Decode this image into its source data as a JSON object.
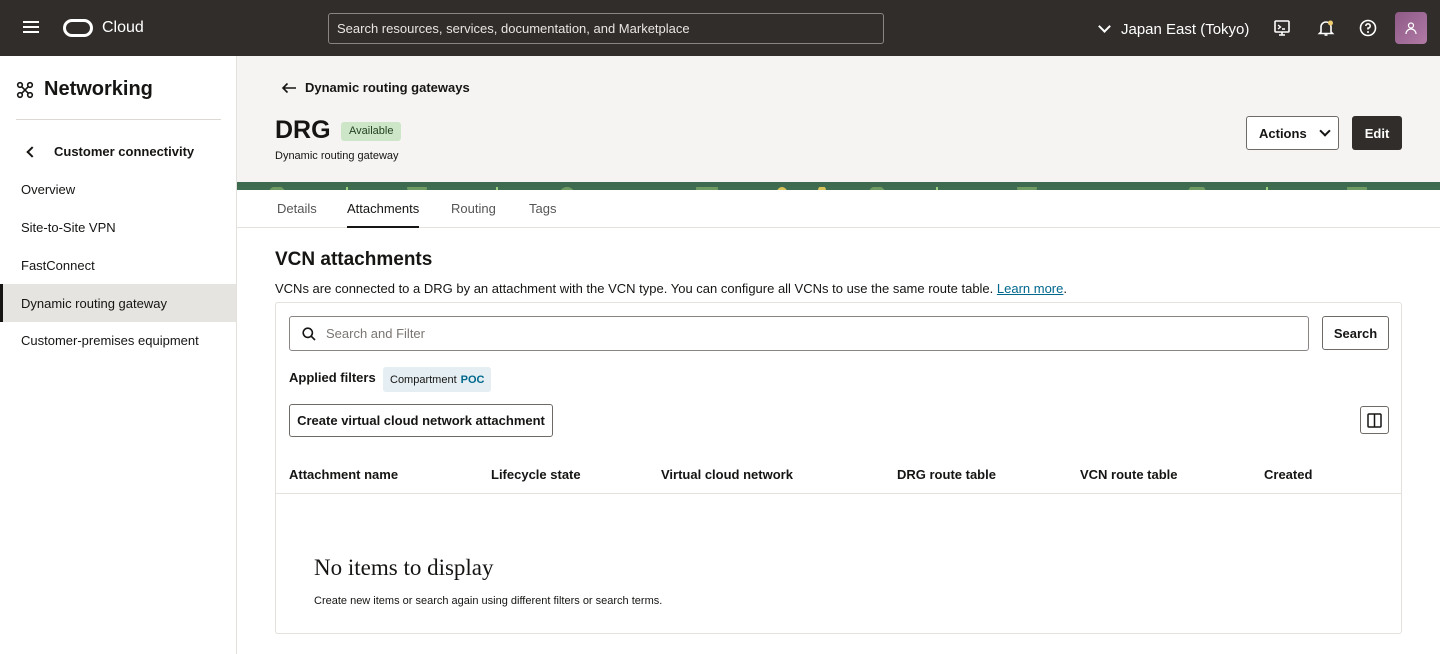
{
  "topbar": {
    "brand": "Cloud",
    "search_placeholder": "Search resources, services, documentation, and Marketplace",
    "region": "Japan East (Tokyo)"
  },
  "sidebar": {
    "title": "Networking",
    "back_label": "Customer connectivity",
    "items": [
      {
        "label": "Overview",
        "active": false
      },
      {
        "label": "Site-to-Site VPN",
        "active": false
      },
      {
        "label": "FastConnect",
        "active": false
      },
      {
        "label": "Dynamic routing gateway",
        "active": true
      },
      {
        "label": "Customer-premises equipment",
        "active": false
      }
    ]
  },
  "header": {
    "breadcrumb": "Dynamic routing gateways",
    "title": "DRG",
    "status_badge": "Available",
    "subtitle": "Dynamic routing gateway",
    "actions_label": "Actions",
    "edit_label": "Edit"
  },
  "tabs": [
    {
      "label": "Details",
      "active": false
    },
    {
      "label": "Attachments",
      "active": true
    },
    {
      "label": "Routing",
      "active": false
    },
    {
      "label": "Tags",
      "active": false
    }
  ],
  "section": {
    "title": "VCN attachments",
    "description": "VCNs are connected to a DRG by an attachment with the VCN type. You can configure all VCNs to use the same route table. ",
    "learn_more": "Learn more",
    "description_end": "."
  },
  "filters": {
    "search_placeholder": "Search and Filter",
    "search_button": "Search",
    "applied_label": "Applied filters",
    "chip_key": "Compartment",
    "chip_value": "POC"
  },
  "create_button": "Create virtual cloud network attachment",
  "table": {
    "columns": [
      "Attachment name",
      "Lifecycle state",
      "Virtual cloud network",
      "DRG route table",
      "VCN route table",
      "Created"
    ],
    "empty_title": "No items to display",
    "empty_desc": "Create new items or search again using different filters or search terms."
  },
  "colors": {
    "topbar": "#312d2a",
    "badge_bg": "#cde6c8",
    "link": "#00688c"
  },
  "icons": [
    "hamburger-icon",
    "oracle-logo-icon",
    "chevron-down-icon",
    "cloud-shell-icon",
    "bell-icon",
    "help-icon",
    "user-avatar-icon",
    "networking-icon",
    "chevron-left-icon",
    "arrow-left-icon",
    "search-icon",
    "columns-icon"
  ]
}
